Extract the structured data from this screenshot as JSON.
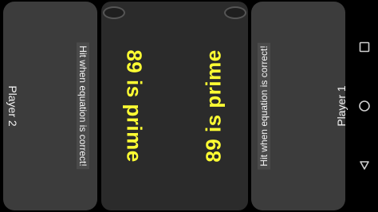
{
  "player_left": {
    "name": "Player 2",
    "hint": "Hit when equation is correct!"
  },
  "player_right": {
    "name": "Player 1",
    "hint": "Hit when equation is correct!"
  },
  "table": {
    "equation_left": "89 is prime",
    "equation_right": "89 is prime"
  },
  "navbar": {
    "recents_icon": "recents-icon",
    "home_icon": "home-icon",
    "back_icon": "back-icon"
  },
  "colors": {
    "equation": "#ffff33",
    "panel": "#3c3c3c",
    "table": "#2b2b2b"
  }
}
